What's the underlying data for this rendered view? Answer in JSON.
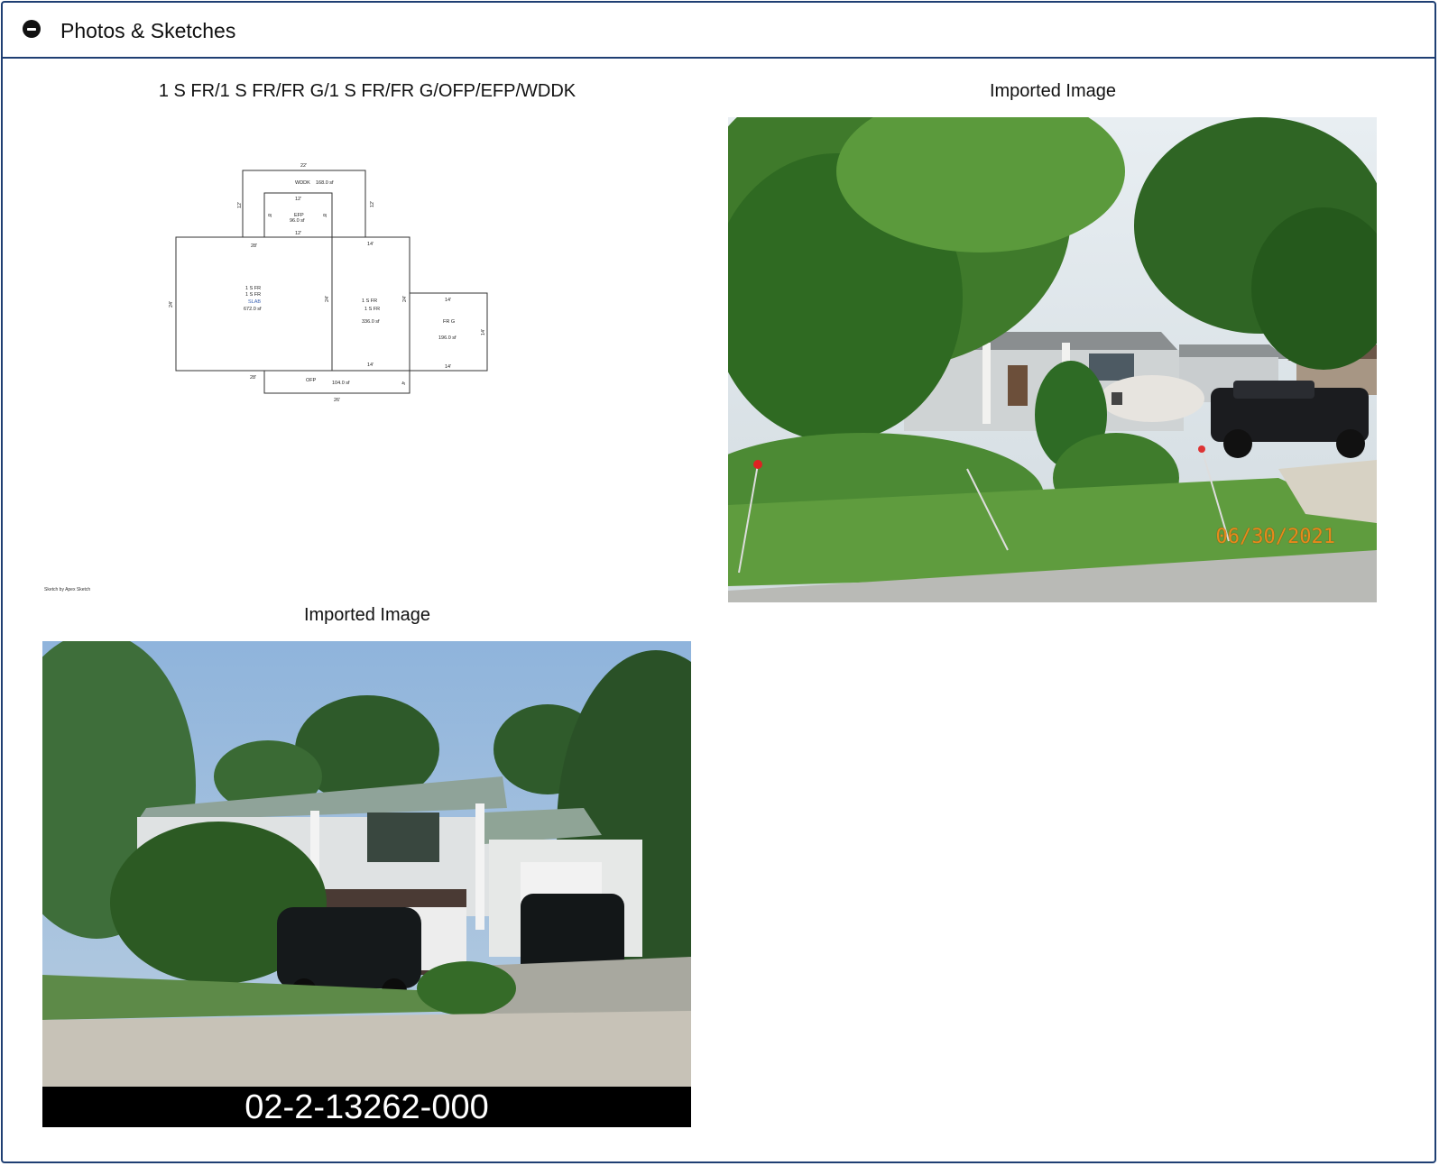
{
  "panel": {
    "title": "Photos & Sketches",
    "collapse_icon": "minus-circle-icon"
  },
  "sketch": {
    "caption": "1 S FR/1 S FR/FR G/1 S FR/FR G/OFP/EFP/WDDK",
    "credit": "Sketch by Apex Sketch",
    "areas": {
      "wddk": {
        "name": "WDDK",
        "area": "168.0 sf"
      },
      "efp": {
        "name": "EFP",
        "area": "96.0 sf"
      },
      "main": {
        "line1": "1 S FR",
        "line2": "1 S FR",
        "line3": "SLAB",
        "area": "672.0 sf"
      },
      "middle": {
        "line1": "1 S FR",
        "line2": "1 S FR",
        "area": "336.0 sf"
      },
      "garage": {
        "name": "FR G",
        "area": "196.0 sf"
      },
      "ofp": {
        "name": "OFP",
        "area": "104.0 sf"
      }
    },
    "dims": {
      "wddk_top": "22'",
      "wddk_left": "12'",
      "wddk_right": "12'",
      "efp_top": "12'",
      "efp_bottom": "12'",
      "efp_left": "8'",
      "efp_right": "8'",
      "main_top": "28'",
      "main_left": "24'",
      "main_right": "24'",
      "main_bottom": "28'",
      "middle_top": "14'",
      "middle_bottom": "14'",
      "middle_right": "24'",
      "garage_top": "14'",
      "garage_bottom": "14'",
      "garage_right": "14'",
      "ofp_bottom": "26'",
      "ofp_right": "4'"
    }
  },
  "photo1": {
    "caption": "Imported Image",
    "date_stamp": "06/30/2021"
  },
  "photo2": {
    "caption": "Imported Image",
    "parcel_number": "02-2-13262-000"
  }
}
